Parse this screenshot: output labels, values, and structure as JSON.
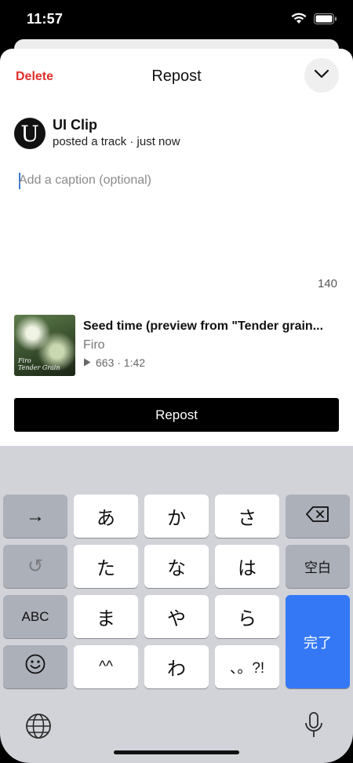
{
  "status_bar": {
    "time": "11:57"
  },
  "header": {
    "delete_label": "Delete",
    "title": "Repost"
  },
  "user": {
    "avatar_letter": "U",
    "name": "UI Clip",
    "subtitle": "posted a track · just now"
  },
  "caption": {
    "placeholder": "Add a caption (optional)",
    "char_count": "140"
  },
  "track": {
    "title": "Seed time (preview from \"Tender grain...",
    "artist": "Firo",
    "stats": "663 · 1:42",
    "artwork_label_line1": "Firo",
    "artwork_label_line2": "Tender Grain"
  },
  "repost_button_label": "Repost",
  "keyboard": {
    "rows": [
      [
        "→",
        "あ",
        "か",
        "さ",
        "⌫"
      ],
      [
        "↺",
        "た",
        "な",
        "は",
        "空白"
      ],
      [
        "ABC",
        "ま",
        "や",
        "ら",
        "完了"
      ],
      [
        "☺",
        "^^",
        "わ",
        "、。?!"
      ]
    ],
    "key_arrow": "→",
    "key_a": "あ",
    "key_ka": "か",
    "key_sa": "さ",
    "key_undo": "↺",
    "key_ta": "た",
    "key_na": "な",
    "key_ha": "は",
    "key_space": "空白",
    "key_abc": "ABC",
    "key_ma": "ま",
    "key_ya": "や",
    "key_ra": "ら",
    "key_done": "完了",
    "key_kaomoji": "^^",
    "key_wa": "わ",
    "key_punct": "、。?!"
  }
}
